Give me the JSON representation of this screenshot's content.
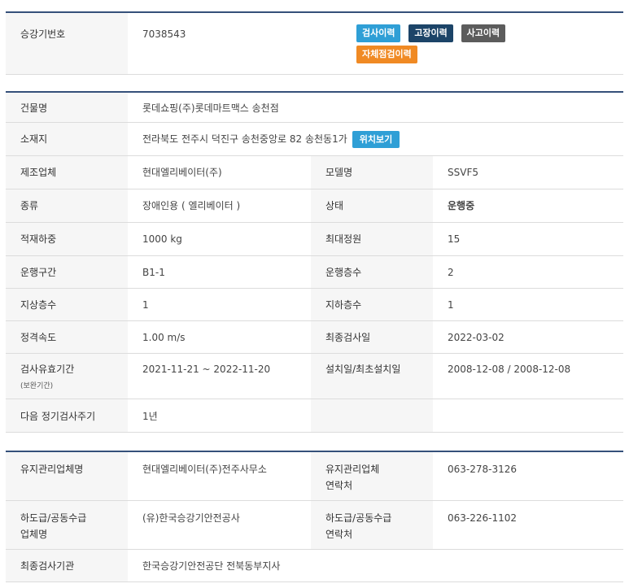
{
  "top": {
    "label": "승강기번호",
    "value": "7038543",
    "buttons": {
      "inspection": "검사이력",
      "fault": "고장이력",
      "accident": "사고이력",
      "self_check": "자체점검이력"
    }
  },
  "info": {
    "building_label": "건물명",
    "building_value": "롯데쇼핑(주)롯데마트맥스 송천점",
    "address_label": "소재지",
    "address_value": "전라북도 전주시 덕진구 송천중앙로 82 송천동1가",
    "map_button": "위치보기",
    "maker_label": "제조업체",
    "maker_value": "현대엘리베이터(주)",
    "model_label": "모델명",
    "model_value": "SSVF5",
    "type_label": "종류",
    "type_value": "장애인용 ( 엘리베이터 )",
    "status_label": "상태",
    "status_value": "운행중",
    "load_label": "적재하중",
    "load_value": "1000 kg",
    "capacity_label": "최대정원",
    "capacity_value": "15",
    "section_label": "운행구간",
    "section_value": "B1-1",
    "floors_label": "운행층수",
    "floors_value": "2",
    "above_label": "지상층수",
    "above_value": "1",
    "below_label": "지하층수",
    "below_value": "1",
    "speed_label": "정격속도",
    "speed_value": "1.00 m/s",
    "last_insp_label": "최종검사일",
    "last_insp_value": "2022-03-02",
    "valid_label": "검사유효기간",
    "valid_sub": "(보완기간)",
    "valid_value": "2021-11-21 ~ 2022-11-20",
    "install_label": "설치일/최초설치일",
    "install_value": "2008-12-08 / 2008-12-08",
    "next_label": "다음 정기검사주기",
    "next_value": "1년"
  },
  "maint": {
    "company_label": "유지관리업체명",
    "company_value": "현대엘리베이터(주)전주사무소",
    "contact_label_1": "유지관리업체",
    "contact_label_2": "연락처",
    "contact_value": "063-278-3126",
    "sub_label_1": "하도급/공동수급",
    "sub_label_2": "업체명",
    "sub_value": "(유)한국승강기안전공사",
    "sub_contact_label_1": "하도급/공동수급",
    "sub_contact_label_2": "연락처",
    "sub_contact_value": "063-226-1102",
    "agency_label": "최종검사기관",
    "agency_value": "한국승강기안전공단 전북동부지사"
  }
}
